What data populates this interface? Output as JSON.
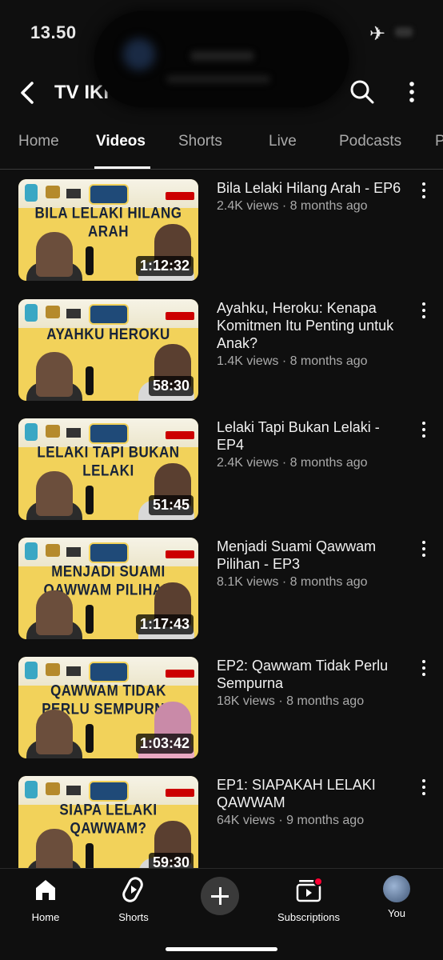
{
  "status_bar": {
    "time": "13.50",
    "airplane_glyph": "✈"
  },
  "header": {
    "channel_title": "TV IKI",
    "back_icon": "back-arrow-icon",
    "search_icon": "search-icon",
    "more_icon": "more-vert-icon"
  },
  "tabs": [
    {
      "label": "Home",
      "active": false
    },
    {
      "label": "Videos",
      "active": true
    },
    {
      "label": "Shorts",
      "active": false
    },
    {
      "label": "Live",
      "active": false
    },
    {
      "label": "Podcasts",
      "active": false
    },
    {
      "label": "P",
      "active": false
    }
  ],
  "videos": [
    {
      "title": "Bila Lelaki Hilang Arah - EP6",
      "meta": "2.4K views · 8 months ago",
      "duration": "1:12:32",
      "thumb_text": "BILA LELAKI HILANG ARAH"
    },
    {
      "title": "Ayahku, Heroku: Kenapa Komitmen Itu Penting untuk Anak?",
      "meta": "1.4K views · 8 months ago",
      "duration": "58:30",
      "thumb_text": "AYAHKU HEROKU"
    },
    {
      "title": "Lelaki Tapi Bukan Lelaki - EP4",
      "meta": "2.4K views · 8 months ago",
      "duration": "51:45",
      "thumb_text": "LELAKI TAPI BUKAN LELAKI"
    },
    {
      "title": "Menjadi Suami Qawwam Pilihan - EP3",
      "meta": "8.1K views · 8 months ago",
      "duration": "1:17:43",
      "thumb_text": "MENJADI SUAMI QAWWAM PILIHAN"
    },
    {
      "title": "EP2: Qawwam Tidak Perlu Sempurna",
      "meta": "18K views · 8 months ago",
      "duration": "1:03:42",
      "thumb_text": "QAWWAM TIDAK PERLU SEMPURNA"
    },
    {
      "title": "EP1: SIAPAKAH LELAKI QAWWAM",
      "meta": "64K views · 9 months ago",
      "duration": "59:30",
      "thumb_text": "SIAPA LELAKI QAWWAM?"
    }
  ],
  "bottom_nav": {
    "home": "Home",
    "shorts": "Shorts",
    "subscriptions": "Subscriptions",
    "you": "You"
  },
  "colors": {
    "background": "#0f0f0f",
    "thumb_yellow": "#f2d25a",
    "accent_red": "#ff0033"
  }
}
